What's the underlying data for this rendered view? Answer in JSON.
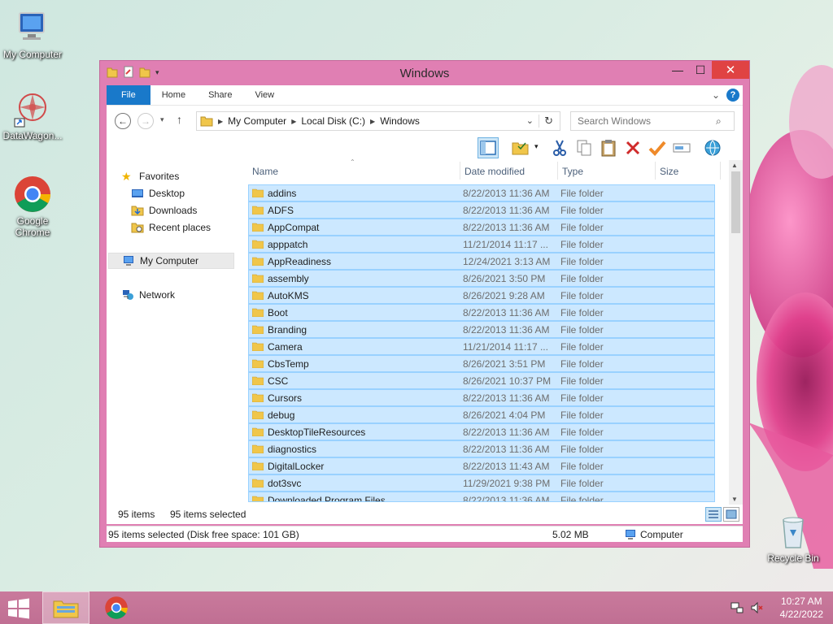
{
  "desktop": {
    "icons": [
      {
        "label": "My Computer"
      },
      {
        "label": "DataWagon..."
      },
      {
        "label": "Google Chrome"
      },
      {
        "label": "Recycle Bin"
      }
    ]
  },
  "window": {
    "title": "Windows",
    "minimize_glyph": "—",
    "maximize_glyph": "☐",
    "close_glyph": "✕"
  },
  "ribbon": {
    "tabs": [
      "File",
      "Home",
      "Share",
      "View"
    ],
    "expand_glyph": "⌄",
    "help_glyph": "?"
  },
  "address": {
    "crumbs": [
      "My Computer",
      "Local Disk (C:)",
      "Windows"
    ],
    "search_placeholder": "Search Windows"
  },
  "nav": {
    "favorites": "Favorites",
    "desktop": "Desktop",
    "downloads": "Downloads",
    "recent": "Recent places",
    "computer": "My Computer",
    "network": "Network"
  },
  "columns": {
    "name": "Name",
    "date": "Date modified",
    "type": "Type",
    "size": "Size"
  },
  "files": [
    {
      "name": "addins",
      "date": "8/22/2013 11:36 AM",
      "type": "File folder"
    },
    {
      "name": "ADFS",
      "date": "8/22/2013 11:36 AM",
      "type": "File folder"
    },
    {
      "name": "AppCompat",
      "date": "8/22/2013 11:36 AM",
      "type": "File folder"
    },
    {
      "name": "apppatch",
      "date": "11/21/2014 11:17 ...",
      "type": "File folder"
    },
    {
      "name": "AppReadiness",
      "date": "12/24/2021 3:13 AM",
      "type": "File folder"
    },
    {
      "name": "assembly",
      "date": "8/26/2021 3:50 PM",
      "type": "File folder"
    },
    {
      "name": "AutoKMS",
      "date": "8/26/2021 9:28 AM",
      "type": "File folder"
    },
    {
      "name": "Boot",
      "date": "8/22/2013 11:36 AM",
      "type": "File folder"
    },
    {
      "name": "Branding",
      "date": "8/22/2013 11:36 AM",
      "type": "File folder"
    },
    {
      "name": "Camera",
      "date": "11/21/2014 11:17 ...",
      "type": "File folder"
    },
    {
      "name": "CbsTemp",
      "date": "8/26/2021 3:51 PM",
      "type": "File folder"
    },
    {
      "name": "CSC",
      "date": "8/26/2021 10:37 PM",
      "type": "File folder"
    },
    {
      "name": "Cursors",
      "date": "8/22/2013 11:36 AM",
      "type": "File folder"
    },
    {
      "name": "debug",
      "date": "8/26/2021 4:04 PM",
      "type": "File folder"
    },
    {
      "name": "DesktopTileResources",
      "date": "8/22/2013 11:36 AM",
      "type": "File folder"
    },
    {
      "name": "diagnostics",
      "date": "8/22/2013 11:36 AM",
      "type": "File folder"
    },
    {
      "name": "DigitalLocker",
      "date": "8/22/2013 11:43 AM",
      "type": "File folder"
    },
    {
      "name": "dot3svc",
      "date": "11/29/2021 9:38 PM",
      "type": "File folder"
    },
    {
      "name": "Downloaded Program Files",
      "date": "8/22/2013 11:36 AM",
      "type": "File folder"
    }
  ],
  "status": {
    "item_count": "95 items",
    "selected_count": "95 items selected",
    "detail": "95 items selected (Disk free space: 101 GB)",
    "size": "5.02 MB",
    "location": "Computer"
  },
  "taskbar": {
    "time": "10:27 AM",
    "date": "4/22/2022"
  },
  "colors": {
    "accent": "#1979ca",
    "window_frame": "#e07fb3",
    "selection": "#cce8ff",
    "selection_border": "#99d1ff",
    "taskbar": "#c4739a"
  }
}
